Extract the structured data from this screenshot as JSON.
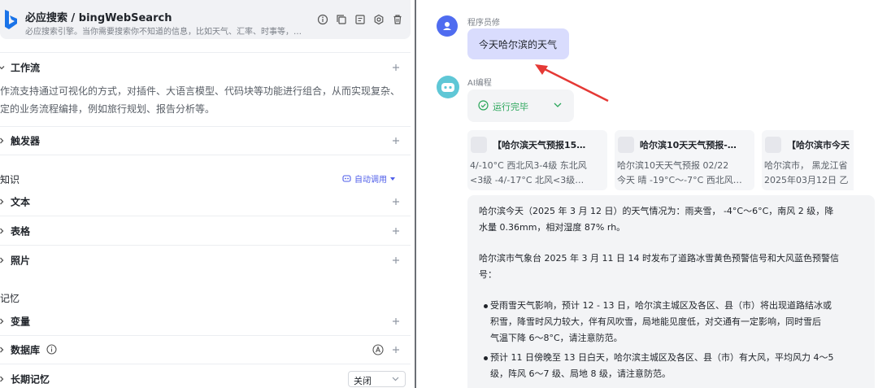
{
  "plugin": {
    "title": "必应搜索 / bingWebSearch",
    "description": "必应搜索引擎。当你需要搜索你不知道的信息，比如天气、汇率、时事等，…",
    "logo_letter": "b",
    "actions": [
      "info-icon",
      "copy-icon",
      "comment-icon",
      "settings-icon",
      "delete-icon"
    ]
  },
  "sections": {
    "workflow_label": "工作流",
    "workflow_desc_1": "作流支持通过可视化的方式，对插件、大语言模型、代码块等功能进行组合，从而实现复杂、",
    "workflow_desc_2": "定的业务流程编排，例如旅行规划、报告分析等。",
    "trigger_label": "触发器",
    "knowledge_label": "知识",
    "auto_call": "自动调用",
    "text_label": "文本",
    "table_label": "表格",
    "photo_label": "照片",
    "memory_label": "记忆",
    "variable_label": "变量",
    "database_label": "数据库",
    "longterm_label": "长期记忆",
    "longterm_value": "关闭"
  },
  "chat": {
    "user_name": "程序员修",
    "user_message": "今天哈尔滨的天气",
    "ai_name": "AI编程",
    "run_status": "运行完毕",
    "cards": [
      {
        "title": "【哈尔滨天气预报15…",
        "line1": "4/-10°C 西北风3-4级 东北风",
        "line2": "<3级 -4/-17°C 北风<3级…"
      },
      {
        "title": "哈尔滨10天天气预报-…",
        "line1": "哈尔滨10天天气预报 02/22",
        "line2": "今天 晴 -19°C～-7°C 西北风…"
      },
      {
        "title": "【哈尔滨市今天",
        "line1": "哈尔滨市， 黑龙江省",
        "line2": "2025年03月12日 乙"
      }
    ],
    "answer_p1_line1": "哈尔滨今天（2025 年 3 月 12 日）的天气情况为：雨夹雪， -4°C～6°C，南风 2 级，降",
    "answer_p1_line2": "水量 0.36mm，相对湿度 87% rh。",
    "answer_p2_line1": "哈尔滨市气象台 2025 年 3 月 11 日 14 时发布了道路冰雪黄色预警信号和大风蓝色预警信",
    "answer_p2_line2": "号：",
    "bullet1_line1": "受雨雪天气影响，预计 12 - 13 日，哈尔滨主城区及各区、县（市）将出现道路结冰或",
    "bullet1_line2": "积雪，降雪时风力较大，伴有风吹雪，局地能见度低，对交通有一定影响，同时雪后",
    "bullet1_line3": "气温下降 6～8°C，请注意防范。",
    "bullet2_line1": "预计 11 日傍晚至 13 日白天，哈尔滨主城区及各区、县（市）有大风，平均风力 4～5",
    "bullet2_line2": "级，阵风 6～7 级、局地 8 级，请注意防范。"
  },
  "colors": {
    "accent": "#4e5de9",
    "user_bubble": "#d9dcfd",
    "success": "#2aa65a",
    "arrow": "#e53935"
  }
}
